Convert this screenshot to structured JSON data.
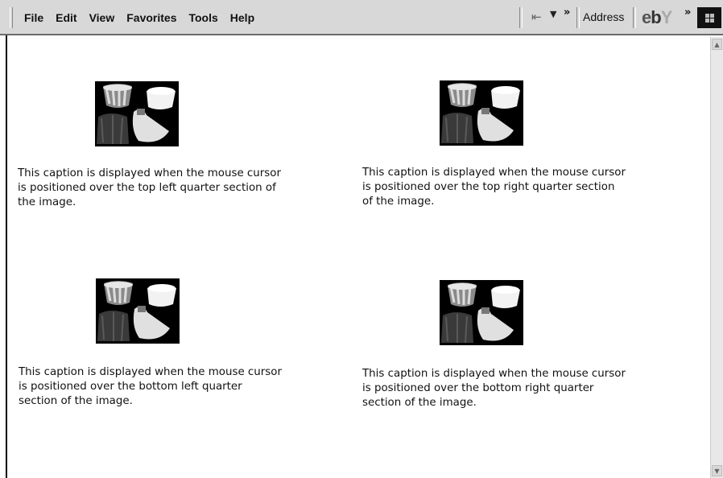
{
  "menu": [
    "File",
    "Edit",
    "View",
    "Favorites",
    "Tools",
    "Help"
  ],
  "toolbar": {
    "back_icon": "back-arrow-icon",
    "dropdown_icon": "dropdown-arrow-icon",
    "chevron": "»",
    "address_label": "Address",
    "logo_text": "ebY"
  },
  "images": [
    {
      "caption": "This caption is displayed when the mouse cursor is positioned over the top left quarter section of the image."
    },
    {
      "caption": "This caption is displayed when the mouse cursor is positioned over the top right quarter section of the image."
    },
    {
      "caption": "This caption is displayed when the mouse cursor is positioned over the bottom left quarter section of the image."
    },
    {
      "caption": "This caption is displayed when the mouse cursor is positioned over the bottom right quarter section of the image."
    }
  ]
}
